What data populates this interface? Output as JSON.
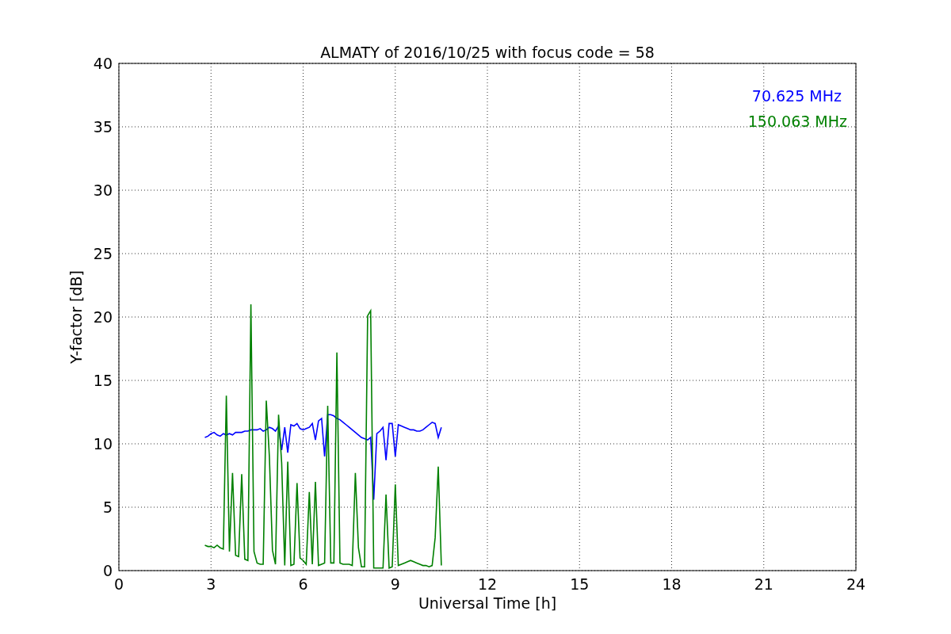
{
  "figure": {
    "chart_data": {
      "type": "line",
      "title": "ALMATY of 2016/10/25 with focus code = 58",
      "xlabel": "Universal Time [h]",
      "ylabel": "Y-factor [dB]",
      "grid": true,
      "xlim": [
        0,
        24
      ],
      "ylim": [
        0,
        40
      ],
      "xticks": [
        0,
        3,
        6,
        9,
        12,
        15,
        18,
        21,
        24
      ],
      "yticks": [
        0,
        5,
        10,
        15,
        20,
        25,
        30,
        35,
        40
      ],
      "x": [
        2.8,
        2.9,
        3.0,
        3.1,
        3.2,
        3.3,
        3.4,
        3.5,
        3.6,
        3.7,
        3.8,
        3.9,
        4.0,
        4.1,
        4.2,
        4.3,
        4.4,
        4.5,
        4.6,
        4.7,
        4.8,
        4.9,
        5.0,
        5.1,
        5.2,
        5.3,
        5.4,
        5.5,
        5.6,
        5.7,
        5.8,
        5.9,
        6.0,
        6.1,
        6.2,
        6.3,
        6.4,
        6.5,
        6.6,
        6.7,
        6.8,
        6.9,
        7.0,
        7.1,
        7.2,
        7.3,
        7.4,
        7.5,
        7.6,
        7.7,
        7.8,
        7.9,
        8.0,
        8.1,
        8.2,
        8.3,
        8.4,
        8.5,
        8.6,
        8.7,
        8.8,
        8.9,
        9.0,
        9.1,
        9.2,
        9.3,
        9.4,
        9.5,
        9.6,
        9.7,
        9.8,
        9.9,
        10.0,
        10.1,
        10.2,
        10.3,
        10.4,
        10.5
      ],
      "series": [
        {
          "name": "70.625 MHz",
          "color": "#0000ff",
          "values": [
            10.5,
            10.6,
            10.8,
            10.9,
            10.7,
            10.6,
            10.8,
            10.7,
            10.8,
            10.7,
            10.9,
            10.9,
            10.9,
            11.0,
            11.0,
            11.1,
            11.1,
            11.1,
            11.2,
            11.0,
            11.1,
            11.3,
            11.2,
            11.0,
            11.4,
            9.5,
            11.3,
            9.3,
            11.5,
            11.4,
            11.6,
            11.2,
            11.1,
            11.2,
            11.3,
            11.6,
            10.3,
            11.8,
            12.0,
            9.0,
            12.3,
            12.3,
            12.2,
            12.0,
            11.9,
            11.7,
            11.5,
            11.3,
            11.1,
            10.9,
            10.7,
            10.5,
            10.4,
            10.3,
            10.5,
            5.6,
            10.8,
            11.0,
            11.3,
            8.7,
            11.6,
            11.6,
            9.0,
            11.5,
            11.4,
            11.3,
            11.2,
            11.1,
            11.1,
            11.0,
            11.0,
            11.1,
            11.3,
            11.5,
            11.7,
            11.6,
            10.5,
            11.3
          ]
        },
        {
          "name": "150.063 MHz",
          "color": "#008000",
          "values": [
            2.0,
            1.9,
            1.9,
            1.8,
            2.0,
            1.8,
            1.7,
            13.8,
            1.5,
            7.7,
            1.2,
            1.1,
            7.6,
            0.9,
            0.8,
            21.0,
            1.5,
            0.6,
            0.5,
            0.5,
            13.4,
            9.0,
            1.6,
            0.5,
            12.3,
            8.5,
            0.4,
            8.6,
            0.4,
            0.5,
            6.9,
            1.0,
            0.8,
            0.5,
            6.2,
            0.5,
            7.0,
            0.4,
            0.5,
            0.6,
            13.0,
            0.6,
            0.6,
            17.2,
            0.6,
            0.5,
            0.5,
            0.5,
            0.4,
            7.7,
            1.8,
            0.3,
            0.3,
            20.1,
            20.5,
            0.2,
            0.2,
            0.2,
            0.2,
            6.0,
            0.2,
            0.3,
            6.8,
            0.4,
            0.5,
            0.6,
            0.7,
            0.8,
            0.7,
            0.6,
            0.5,
            0.4,
            0.4,
            0.3,
            0.4,
            2.6,
            8.2,
            0.4
          ]
        }
      ]
    }
  }
}
